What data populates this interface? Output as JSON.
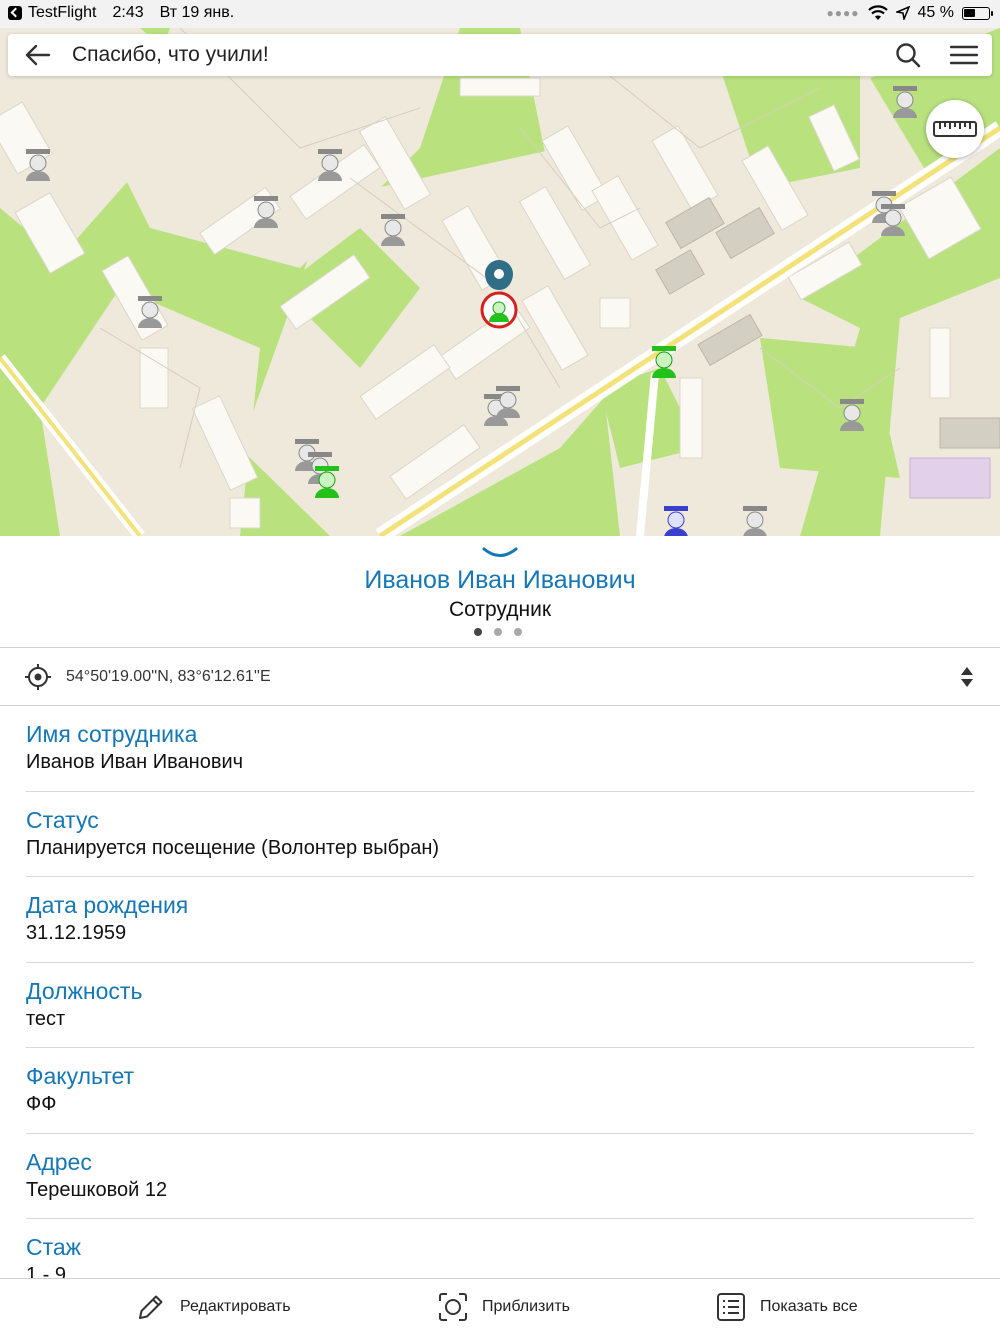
{
  "status_bar": {
    "app_name": "TestFlight",
    "time": "2:43",
    "date": "Вт 19 янв.",
    "battery": "45 %"
  },
  "header": {
    "title": "Спасибо, что учили!"
  },
  "colors": {
    "accent": "#1577b5",
    "map_green": "#b9e27f",
    "map_land": "#efe9dc",
    "road_yellow": "#f3e27a",
    "marker_active": "#22c21b",
    "marker_inactive": "#9a9a9a"
  },
  "icons": {
    "back": "arrow-left-icon",
    "search": "search-icon",
    "menu": "hamburger-menu-icon",
    "ruler": "ruler-icon",
    "location": "crosshair-icon",
    "sort": "sort-updown-icon",
    "edit": "pencil-icon",
    "zoom": "zoom-frame-icon",
    "show_all": "list-icon"
  },
  "card": {
    "name": "Иванов Иван Иванович",
    "role": "Сотрудник",
    "page_index": 1,
    "page_count": 3,
    "coordinates": "54°50'19.00''N, 83°6'12.61''E"
  },
  "fields": [
    {
      "label": "Имя сотрудника",
      "value": "Иванов Иван Иванович"
    },
    {
      "label": "Статус",
      "value": "Планируется посещение (Волонтер выбран)"
    },
    {
      "label": "Дата рождения",
      "value": "31.12.1959"
    },
    {
      "label": "Должность",
      "value": "тест"
    },
    {
      "label": "Факультет",
      "value": "ФФ"
    },
    {
      "label": "Адрес",
      "value": "Терешковой 12"
    },
    {
      "label": "Стаж",
      "value": "1 - 9"
    }
  ],
  "toolbar": {
    "edit_label": "Редактировать",
    "zoom_label": "Приблизить",
    "show_all_label": "Показать все"
  }
}
